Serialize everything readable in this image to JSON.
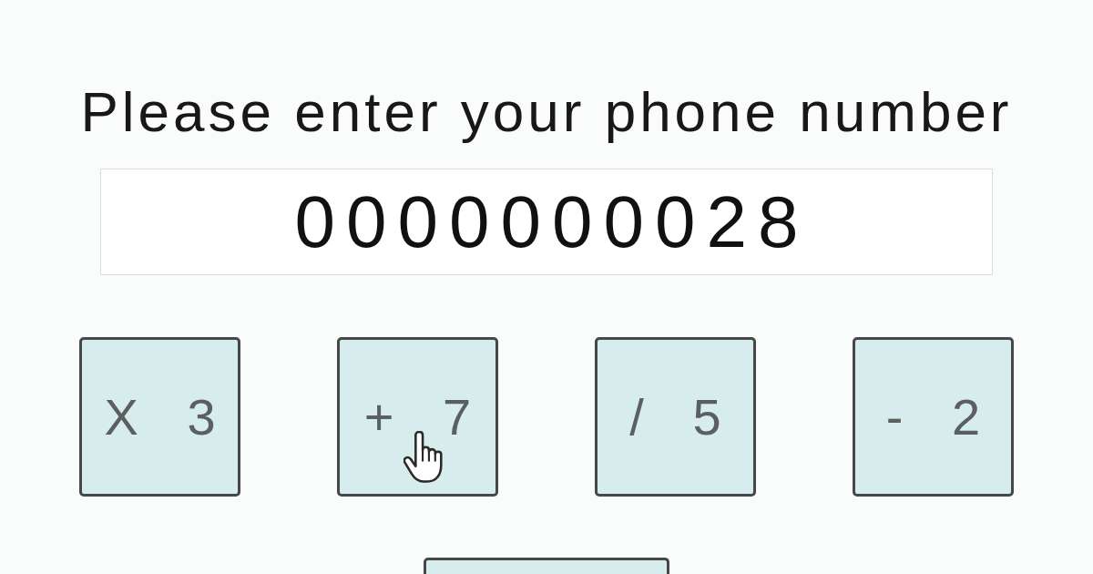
{
  "prompt": "Please enter your phone number",
  "phone_field": {
    "value": "0000000028"
  },
  "keys": [
    {
      "label": "X 3",
      "hovered": false
    },
    {
      "label": "+ 7",
      "hovered": true
    },
    {
      "label": "/ 5",
      "hovered": false
    },
    {
      "label": "- 2",
      "hovered": false
    }
  ]
}
